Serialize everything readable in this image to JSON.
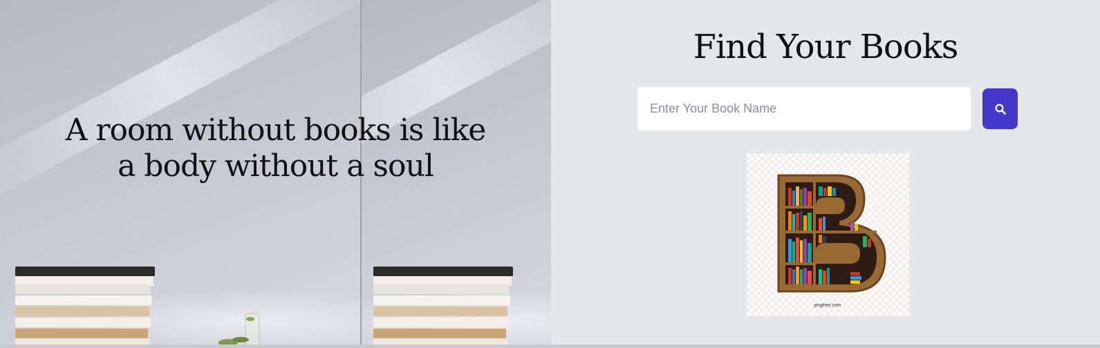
{
  "hero": {
    "quote_line1": "A room without books is like",
    "quote_line2": "a body without a soul"
  },
  "search": {
    "title": "Find Your Books",
    "placeholder": "Enter Your Book Name",
    "button_icon": "search-icon"
  },
  "logo": {
    "letter": "B",
    "watermark": "pngtree.com"
  },
  "colors": {
    "accent": "#4338ca",
    "page_background": "#e5e7eb",
    "input_background": "#ffffff"
  }
}
